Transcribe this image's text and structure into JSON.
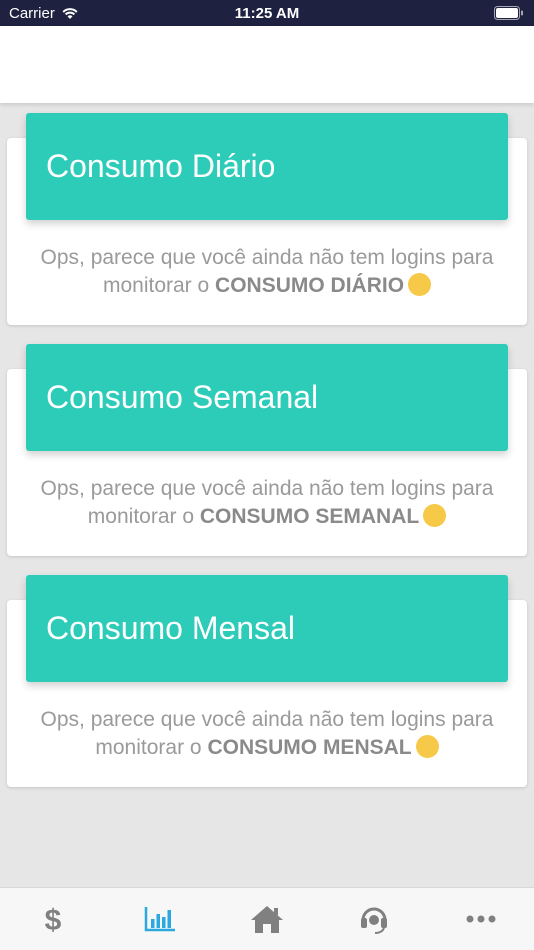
{
  "status_bar": {
    "carrier": "Carrier",
    "time": "11:25 AM"
  },
  "cards": [
    {
      "title": "Consumo Diário",
      "message_prefix": "Ops, parece que você ainda não tem logins para monitorar o",
      "message_bold": "CONSUMO DIÁRIO"
    },
    {
      "title": "Consumo Semanal",
      "message_prefix": "Ops, parece que você ainda não tem logins para monitorar o",
      "message_bold": "CONSUMO SEMANAL"
    },
    {
      "title": "Consumo Mensal",
      "message_prefix": "Ops, parece que você ainda não tem logins para monitorar o",
      "message_bold": "CONSUMO MENSAL"
    }
  ],
  "tab_bar": {
    "active_tab": "chart",
    "active_color": "#2aa8e0",
    "inactive_color": "#808080",
    "tabs": [
      "dollar-icon",
      "bar-chart-icon",
      "home-icon",
      "headset-icon",
      "more-icon"
    ]
  },
  "colors": {
    "card_header": "#2dccb9",
    "status_bar": "#1e2140"
  }
}
